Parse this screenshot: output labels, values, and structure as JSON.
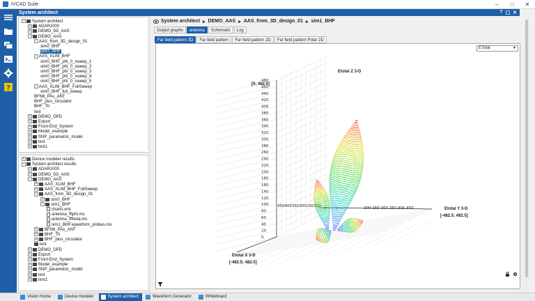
{
  "window": {
    "title": "IVCAD Suite"
  },
  "panel": {
    "title": "System architect"
  },
  "breadcrumb": [
    "System architect",
    "DEMO_AAS",
    "AAS_from_3D_design_01",
    "sim1_BHF"
  ],
  "tabs_primary": [
    {
      "label": "Output graphs"
    },
    {
      "label": "antenna",
      "active": true
    },
    {
      "label": "Schematic"
    },
    {
      "label": "Log"
    }
  ],
  "tabs_secondary": [
    {
      "label": "Far field pattern 3D",
      "active": true
    },
    {
      "label": "Far field pattern"
    },
    {
      "label": "Far field pattern 2D"
    },
    {
      "label": "Far field pattern Polar 2D"
    }
  ],
  "dropdown": {
    "selected": "ETotal"
  },
  "tree_top": [
    {
      "depth": 0,
      "label": "System architect",
      "expanded": true,
      "kind": "folder"
    },
    {
      "depth": 1,
      "label": "ADAR1000",
      "expanded": false,
      "kind": "folder"
    },
    {
      "depth": 1,
      "label": "DEMO_5G_AAS",
      "expanded": false,
      "kind": "folder"
    },
    {
      "depth": 1,
      "label": "DEMO_AAS",
      "expanded": true,
      "kind": "folder"
    },
    {
      "depth": 2,
      "label": "AAS_from_3D_design_01",
      "expanded": true,
      "kind": "leaf"
    },
    {
      "depth": 3,
      "label": "sim0_BHF",
      "kind": "leaf"
    },
    {
      "depth": 3,
      "label": "sim1_BHF",
      "kind": "leaf",
      "selected": true
    },
    {
      "depth": 2,
      "label": "AAS_XLIM_BHF",
      "expanded": true,
      "kind": "leaf"
    },
    {
      "depth": 3,
      "label": "sim0_BHF_phi_0_sweep_1",
      "kind": "leaf"
    },
    {
      "depth": 3,
      "label": "sim0_BHF_phi_0_sweep_2",
      "kind": "leaf"
    },
    {
      "depth": 3,
      "label": "sim0_BHF_phi_0_sweep_3",
      "kind": "leaf"
    },
    {
      "depth": 3,
      "label": "sim0_BHF_phi_0_sweep_4",
      "kind": "leaf"
    },
    {
      "depth": 3,
      "label": "sim0_BHF_phi_0_sweep_5",
      "kind": "leaf"
    },
    {
      "depth": 2,
      "label": "AAS_XLIM_BHF_FullSweep",
      "expanded": true,
      "kind": "leaf"
    },
    {
      "depth": 3,
      "label": "sim0_BHF_full_sweep",
      "kind": "leaf"
    },
    {
      "depth": 2,
      "label": "BFN6_PAs_ANT",
      "kind": "leaf"
    },
    {
      "depth": 2,
      "label": "BHF_plus_circulator",
      "kind": "leaf"
    },
    {
      "depth": 2,
      "label": "BHF_Th",
      "kind": "leaf"
    },
    {
      "depth": 2,
      "label": "test",
      "kind": "leaf"
    },
    {
      "depth": 1,
      "label": "DEMO_DPD",
      "expanded": false,
      "kind": "folder"
    },
    {
      "depth": 1,
      "label": "Export",
      "expanded": false,
      "kind": "folder"
    },
    {
      "depth": 1,
      "label": "Front-End_System",
      "expanded": false,
      "kind": "folder"
    },
    {
      "depth": 1,
      "label": "Model_example",
      "expanded": false,
      "kind": "folder"
    },
    {
      "depth": 1,
      "label": "SNP_parametric_model",
      "expanded": false,
      "kind": "folder"
    },
    {
      "depth": 1,
      "label": "test",
      "expanded": false,
      "kind": "folder"
    },
    {
      "depth": 1,
      "label": "test1",
      "expanded": false,
      "kind": "folder"
    }
  ],
  "tree_bottom": [
    {
      "depth": 0,
      "label": "Device modeler results",
      "expanded": false,
      "kind": "folder"
    },
    {
      "depth": 0,
      "label": "System architect results",
      "expanded": true,
      "kind": "folder"
    },
    {
      "depth": 1,
      "label": "ADAR1000",
      "expanded": false,
      "kind": "folder"
    },
    {
      "depth": 1,
      "label": "DEMO_5G_AAS",
      "expanded": false,
      "kind": "folder"
    },
    {
      "depth": 1,
      "label": "DEMO_AAS",
      "expanded": true,
      "kind": "folder"
    },
    {
      "depth": 2,
      "label": "AAS_XLIM_BHF",
      "expanded": false,
      "kind": "folder"
    },
    {
      "depth": 2,
      "label": "AAS_XLIM_BHF_FullSweep",
      "expanded": false,
      "kind": "folder"
    },
    {
      "depth": 2,
      "label": "AAS_from_3D_design_01",
      "expanded": true,
      "kind": "folder"
    },
    {
      "depth": 3,
      "label": "sim0_BHF",
      "expanded": false,
      "kind": "folder"
    },
    {
      "depth": 3,
      "label": "sim1_BHF",
      "expanded": true,
      "kind": "folder"
    },
    {
      "depth": 4,
      "label": "charts.xml",
      "kind": "file"
    },
    {
      "depth": 4,
      "label": "antenna_fftphi.mx",
      "kind": "file"
    },
    {
      "depth": 4,
      "label": "antenna_fftheta.mx",
      "kind": "file"
    },
    {
      "depth": 4,
      "label": "sim1_BHF.waveform_probes.mx",
      "kind": "file"
    },
    {
      "depth": 2,
      "label": "BFN6_PAs_ANT",
      "expanded": false,
      "kind": "folder"
    },
    {
      "depth": 2,
      "label": "BHF_Th",
      "expanded": false,
      "kind": "folder"
    },
    {
      "depth": 2,
      "label": "BHF_plus_circulator",
      "expanded": false,
      "kind": "folder"
    },
    {
      "depth": 2,
      "label": "test",
      "kind": "folder"
    },
    {
      "depth": 1,
      "label": "DEMO_DPD",
      "expanded": false,
      "kind": "folder"
    },
    {
      "depth": 1,
      "label": "Export",
      "expanded": false,
      "kind": "folder"
    },
    {
      "depth": 1,
      "label": "Front-End_System",
      "expanded": false,
      "kind": "folder"
    },
    {
      "depth": 1,
      "label": "Model_example",
      "expanded": false,
      "kind": "folder"
    },
    {
      "depth": 1,
      "label": "SNP_parametric_model",
      "expanded": false,
      "kind": "folder"
    },
    {
      "depth": 1,
      "label": "test",
      "expanded": false,
      "kind": "folder"
    },
    {
      "depth": 1,
      "label": "test1",
      "expanded": false,
      "kind": "folder"
    }
  ],
  "plot": {
    "title": "Etotal Z 3-D",
    "z_label": "[0; 482.5]",
    "z_ticks": [
      0,
      20,
      40,
      60,
      80,
      100,
      120,
      140,
      160,
      180,
      200,
      220,
      240,
      260,
      280,
      300,
      320,
      340,
      360,
      380,
      400,
      420,
      440,
      460,
      480
    ],
    "x_axis_ticks_text": "450400350300250200",
    "y_axis_ticks_text": "200 250 300 350 400 450",
    "y_label": "Etotal Y 3-D",
    "y_range": "[-482.5; 482.5]",
    "x_label": "Etotal X 3-D",
    "x_range": "[-482.5; 482.5]",
    "colormap": [
      "#1a3cff",
      "#00c8c8",
      "#30d030",
      "#e0e000",
      "#ff2020"
    ]
  },
  "statusbar": [
    {
      "label": "Vision Home",
      "active": false
    },
    {
      "label": "Device modeler",
      "active": false
    },
    {
      "label": "System architect",
      "active": true
    },
    {
      "label": "Waveform Generator",
      "active": false
    },
    {
      "label": "Whiteboard",
      "active": false
    }
  ]
}
